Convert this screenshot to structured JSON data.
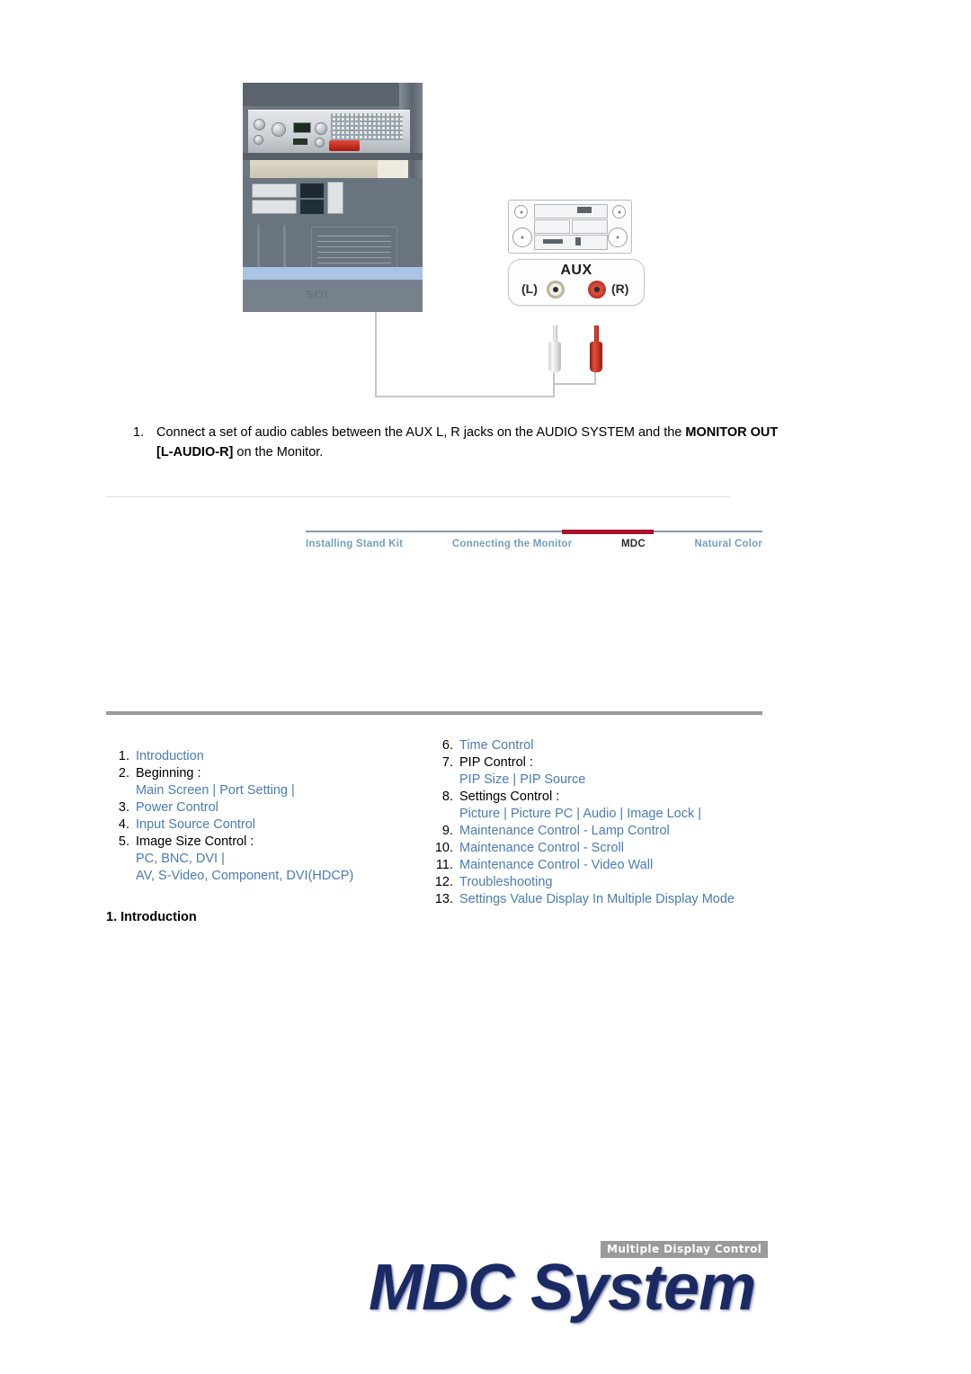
{
  "illustration": {
    "photo_alt_label": "monitor-rear-panel-photo",
    "photo_base_text": "SOI",
    "aux": {
      "title": "AUX",
      "left_label": "(L)",
      "right_label": "(R)"
    }
  },
  "step": {
    "number": "1.",
    "text_before_bold": "Connect a set of audio cables between the AUX L, R jacks on the AUDIO SYSTEM and the ",
    "bold_text": "MONITOR OUT [L-AUDIO-R]",
    "text_after_bold": " on the Monitor."
  },
  "nav": {
    "active_color": "#a9132a",
    "link_color": "#74a0bf",
    "items": [
      {
        "label": "Installing Stand Kit",
        "active": false
      },
      {
        "label": "Connecting the Monitor",
        "active": false
      },
      {
        "label": "MDC",
        "active": true
      },
      {
        "label": "Natural Color",
        "active": false
      }
    ]
  },
  "banner": {
    "badge": "Multiple Display Control",
    "title": "MDC System",
    "title_color": "#1b2a63"
  },
  "toc": {
    "link_color": "#4a7cb5",
    "left": [
      {
        "num": "1.",
        "label": "Introduction",
        "link": true
      },
      {
        "num": "2.",
        "label": "Beginning :",
        "link": false,
        "sub": [
          "Main Screen",
          "Port Setting",
          ""
        ]
      },
      {
        "num": "3.",
        "label": "Power Control",
        "link": true
      },
      {
        "num": "4.",
        "label": "Input Source Control",
        "link": true
      },
      {
        "num": "5.",
        "label": "Image Size Control :",
        "link": false,
        "sub": [
          "PC, BNC, DVI",
          "AV, S-Video, Component, DVI(HDCP)"
        ]
      }
    ],
    "right": [
      {
        "num": "6.",
        "label": "Time Control",
        "link": true
      },
      {
        "num": "7.",
        "label": "PIP Control :",
        "link": false,
        "sub": [
          "PIP Size",
          "PIP Source"
        ]
      },
      {
        "num": "8.",
        "label": "Settings Control :",
        "link": false,
        "sub": [
          "Picture",
          "Picture PC",
          "Audio",
          "Image Lock",
          ""
        ]
      },
      {
        "num": "9.",
        "label": "Maintenance Control - Lamp Control",
        "link": true
      },
      {
        "num": "10.",
        "label": "Maintenance Control - Scroll",
        "link": true
      },
      {
        "num": "11.",
        "label": "Maintenance Control - Video Wall",
        "link": true
      },
      {
        "num": "12.",
        "label": "Troubleshooting",
        "link": true
      },
      {
        "num": "13.",
        "label": "Settings Value Display In Multiple Display Mode",
        "link": true
      }
    ]
  },
  "section_heading": "1. Introduction"
}
